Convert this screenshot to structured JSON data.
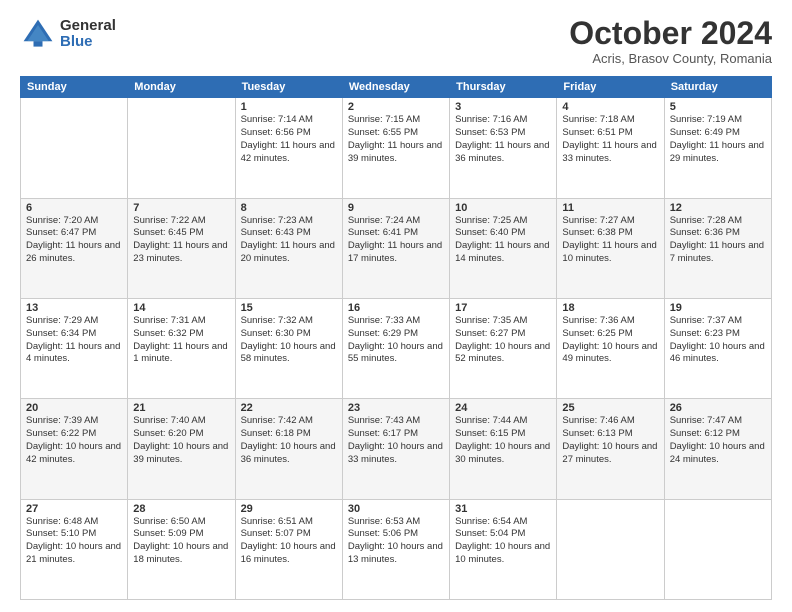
{
  "logo": {
    "general": "General",
    "blue": "Blue"
  },
  "header": {
    "month": "October 2024",
    "subtitle": "Acris, Brasov County, Romania"
  },
  "weekdays": [
    "Sunday",
    "Monday",
    "Tuesday",
    "Wednesday",
    "Thursday",
    "Friday",
    "Saturday"
  ],
  "weeks": [
    [
      {
        "day": "",
        "sunrise": "",
        "sunset": "",
        "daylight": ""
      },
      {
        "day": "",
        "sunrise": "",
        "sunset": "",
        "daylight": ""
      },
      {
        "day": "1",
        "sunrise": "Sunrise: 7:14 AM",
        "sunset": "Sunset: 6:56 PM",
        "daylight": "Daylight: 11 hours and 42 minutes."
      },
      {
        "day": "2",
        "sunrise": "Sunrise: 7:15 AM",
        "sunset": "Sunset: 6:55 PM",
        "daylight": "Daylight: 11 hours and 39 minutes."
      },
      {
        "day": "3",
        "sunrise": "Sunrise: 7:16 AM",
        "sunset": "Sunset: 6:53 PM",
        "daylight": "Daylight: 11 hours and 36 minutes."
      },
      {
        "day": "4",
        "sunrise": "Sunrise: 7:18 AM",
        "sunset": "Sunset: 6:51 PM",
        "daylight": "Daylight: 11 hours and 33 minutes."
      },
      {
        "day": "5",
        "sunrise": "Sunrise: 7:19 AM",
        "sunset": "Sunset: 6:49 PM",
        "daylight": "Daylight: 11 hours and 29 minutes."
      }
    ],
    [
      {
        "day": "6",
        "sunrise": "Sunrise: 7:20 AM",
        "sunset": "Sunset: 6:47 PM",
        "daylight": "Daylight: 11 hours and 26 minutes."
      },
      {
        "day": "7",
        "sunrise": "Sunrise: 7:22 AM",
        "sunset": "Sunset: 6:45 PM",
        "daylight": "Daylight: 11 hours and 23 minutes."
      },
      {
        "day": "8",
        "sunrise": "Sunrise: 7:23 AM",
        "sunset": "Sunset: 6:43 PM",
        "daylight": "Daylight: 11 hours and 20 minutes."
      },
      {
        "day": "9",
        "sunrise": "Sunrise: 7:24 AM",
        "sunset": "Sunset: 6:41 PM",
        "daylight": "Daylight: 11 hours and 17 minutes."
      },
      {
        "day": "10",
        "sunrise": "Sunrise: 7:25 AM",
        "sunset": "Sunset: 6:40 PM",
        "daylight": "Daylight: 11 hours and 14 minutes."
      },
      {
        "day": "11",
        "sunrise": "Sunrise: 7:27 AM",
        "sunset": "Sunset: 6:38 PM",
        "daylight": "Daylight: 11 hours and 10 minutes."
      },
      {
        "day": "12",
        "sunrise": "Sunrise: 7:28 AM",
        "sunset": "Sunset: 6:36 PM",
        "daylight": "Daylight: 11 hours and 7 minutes."
      }
    ],
    [
      {
        "day": "13",
        "sunrise": "Sunrise: 7:29 AM",
        "sunset": "Sunset: 6:34 PM",
        "daylight": "Daylight: 11 hours and 4 minutes."
      },
      {
        "day": "14",
        "sunrise": "Sunrise: 7:31 AM",
        "sunset": "Sunset: 6:32 PM",
        "daylight": "Daylight: 11 hours and 1 minute."
      },
      {
        "day": "15",
        "sunrise": "Sunrise: 7:32 AM",
        "sunset": "Sunset: 6:30 PM",
        "daylight": "Daylight: 10 hours and 58 minutes."
      },
      {
        "day": "16",
        "sunrise": "Sunrise: 7:33 AM",
        "sunset": "Sunset: 6:29 PM",
        "daylight": "Daylight: 10 hours and 55 minutes."
      },
      {
        "day": "17",
        "sunrise": "Sunrise: 7:35 AM",
        "sunset": "Sunset: 6:27 PM",
        "daylight": "Daylight: 10 hours and 52 minutes."
      },
      {
        "day": "18",
        "sunrise": "Sunrise: 7:36 AM",
        "sunset": "Sunset: 6:25 PM",
        "daylight": "Daylight: 10 hours and 49 minutes."
      },
      {
        "day": "19",
        "sunrise": "Sunrise: 7:37 AM",
        "sunset": "Sunset: 6:23 PM",
        "daylight": "Daylight: 10 hours and 46 minutes."
      }
    ],
    [
      {
        "day": "20",
        "sunrise": "Sunrise: 7:39 AM",
        "sunset": "Sunset: 6:22 PM",
        "daylight": "Daylight: 10 hours and 42 minutes."
      },
      {
        "day": "21",
        "sunrise": "Sunrise: 7:40 AM",
        "sunset": "Sunset: 6:20 PM",
        "daylight": "Daylight: 10 hours and 39 minutes."
      },
      {
        "day": "22",
        "sunrise": "Sunrise: 7:42 AM",
        "sunset": "Sunset: 6:18 PM",
        "daylight": "Daylight: 10 hours and 36 minutes."
      },
      {
        "day": "23",
        "sunrise": "Sunrise: 7:43 AM",
        "sunset": "Sunset: 6:17 PM",
        "daylight": "Daylight: 10 hours and 33 minutes."
      },
      {
        "day": "24",
        "sunrise": "Sunrise: 7:44 AM",
        "sunset": "Sunset: 6:15 PM",
        "daylight": "Daylight: 10 hours and 30 minutes."
      },
      {
        "day": "25",
        "sunrise": "Sunrise: 7:46 AM",
        "sunset": "Sunset: 6:13 PM",
        "daylight": "Daylight: 10 hours and 27 minutes."
      },
      {
        "day": "26",
        "sunrise": "Sunrise: 7:47 AM",
        "sunset": "Sunset: 6:12 PM",
        "daylight": "Daylight: 10 hours and 24 minutes."
      }
    ],
    [
      {
        "day": "27",
        "sunrise": "Sunrise: 6:48 AM",
        "sunset": "Sunset: 5:10 PM",
        "daylight": "Daylight: 10 hours and 21 minutes."
      },
      {
        "day": "28",
        "sunrise": "Sunrise: 6:50 AM",
        "sunset": "Sunset: 5:09 PM",
        "daylight": "Daylight: 10 hours and 18 minutes."
      },
      {
        "day": "29",
        "sunrise": "Sunrise: 6:51 AM",
        "sunset": "Sunset: 5:07 PM",
        "daylight": "Daylight: 10 hours and 16 minutes."
      },
      {
        "day": "30",
        "sunrise": "Sunrise: 6:53 AM",
        "sunset": "Sunset: 5:06 PM",
        "daylight": "Daylight: 10 hours and 13 minutes."
      },
      {
        "day": "31",
        "sunrise": "Sunrise: 6:54 AM",
        "sunset": "Sunset: 5:04 PM",
        "daylight": "Daylight: 10 hours and 10 minutes."
      },
      {
        "day": "",
        "sunrise": "",
        "sunset": "",
        "daylight": ""
      },
      {
        "day": "",
        "sunrise": "",
        "sunset": "",
        "daylight": ""
      }
    ]
  ]
}
